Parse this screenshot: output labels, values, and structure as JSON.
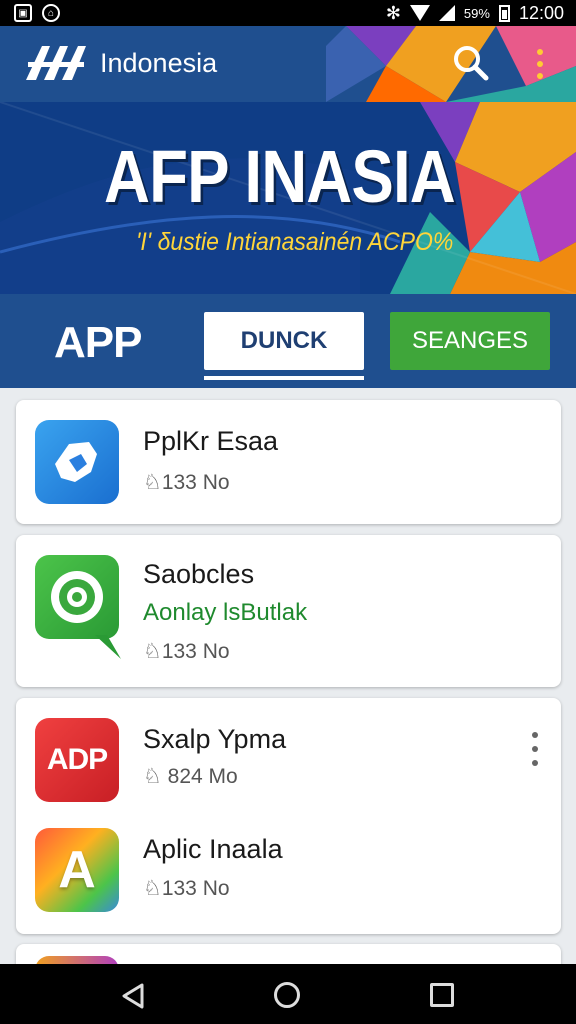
{
  "status_bar": {
    "battery_label": "59%",
    "time": "12:00"
  },
  "app_bar": {
    "title": "Indonesia",
    "logo_icon": "afp-logo-icon",
    "search_icon": "search-icon",
    "more_icon": "more-vert-icon"
  },
  "banner": {
    "title": "AFP INASIA",
    "subtitle": "'I' δustie Intianasainén ACPO%"
  },
  "tabs": {
    "logo_text": "APP",
    "items": [
      {
        "label": "DUNCK"
      },
      {
        "label": "SEANGES"
      }
    ]
  },
  "list": [
    {
      "name": "PplKr Esaa",
      "meta": "♘133 No",
      "icon": "blue-badge-icon"
    },
    {
      "name": "Saobcles",
      "subtitle": "Aonlay lsButlak",
      "meta": "♘133 No",
      "icon": "green-gear-chat-icon"
    },
    {
      "name": "Sxalp Ypma",
      "meta": "♘ 824 Mo",
      "icon": "red-adp-icon",
      "icon_text": "ADP"
    },
    {
      "name": "Aplic Inaala",
      "meta": "♘133 No",
      "icon": "rainbow-a-icon",
      "icon_text": "A"
    }
  ],
  "colors": {
    "primary": "#1f4f8f",
    "accent_green": "#3fa63a",
    "banner_title": "#ffffff",
    "banner_subtitle": "#ffd53a"
  },
  "nav": {
    "back_icon": "back-icon",
    "home_icon": "home-icon",
    "recents_icon": "recents-icon"
  }
}
